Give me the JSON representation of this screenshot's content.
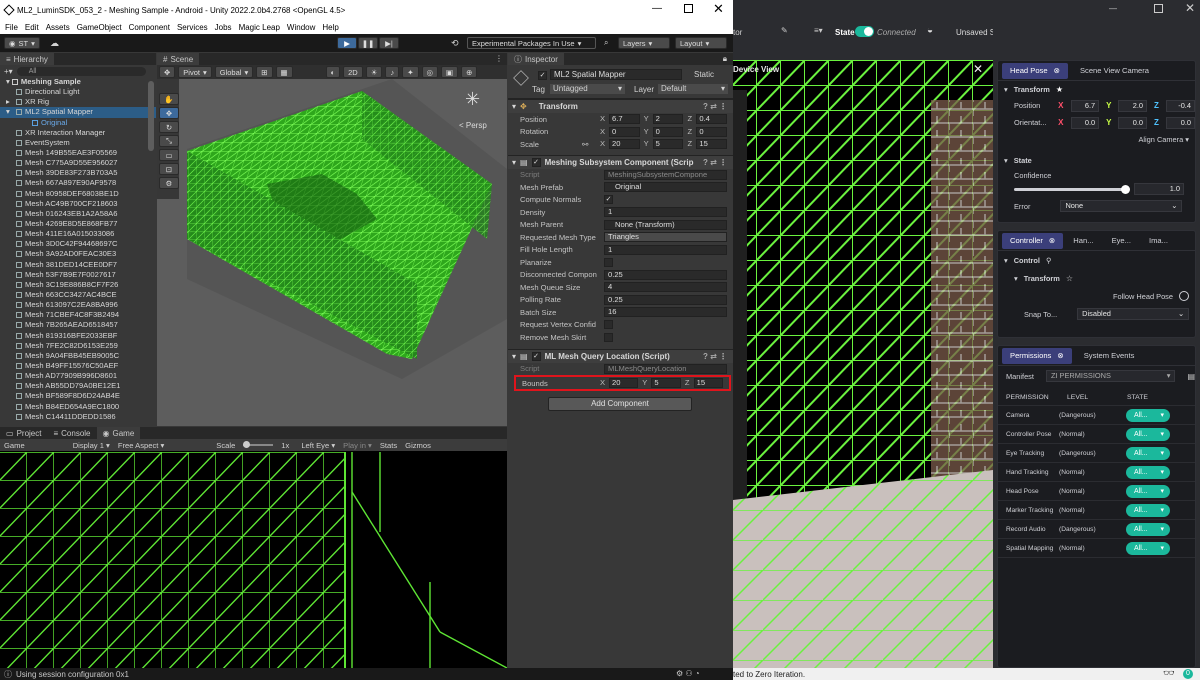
{
  "unity": {
    "title": "ML2_LuminSDK_053_2 - Meshing Sample - Android - Unity 2022.2.0b4.2768 <OpenGL 4.5>",
    "menu": [
      "File",
      "Edit",
      "Assets",
      "GameObject",
      "Component",
      "Services",
      "Jobs",
      "Magic Leap",
      "Window",
      "Help"
    ],
    "account": "ST",
    "experimental": "Experimental Packages In Use",
    "layers": "Layers",
    "layout": "Layout",
    "hierarchy_tab": "Hierarchy",
    "search_placeholder": "All",
    "scene_root": "Meshing Sample",
    "hierarchy": [
      "Directional Light",
      "XR Rig",
      "ML2 Spatial Mapper",
      "Original",
      "XR Interaction Manager",
      "EventSystem",
      "Mesh 149B55EAE3F05569",
      "Mesh C775A9D55E956027",
      "Mesh 39DE83F273B703A5",
      "Mesh 667A897E90AF9578",
      "Mesh 80958DEF6803BE1D",
      "Mesh AC49B700CF218603",
      "Mesh 016243EB1A2A58A6",
      "Mesh 4269E8D5E868FB77",
      "Mesh 411E16A015033086",
      "Mesh 3D0C42F94468697C",
      "Mesh 3A92AD0FEAC30E3",
      "Mesh 381DED14CEE0DF7",
      "Mesh 53F7B9E7F0027617",
      "Mesh 3C19E886B8CF7F26",
      "Mesh 663CC3427AC4BCE",
      "Mesh 613097C2EA8BA996",
      "Mesh 71CBEF4C8F3B2494",
      "Mesh 7B265AEAD6518457",
      "Mesh 819316BFE2033EBF",
      "Mesh 7FE2C82D6153E259",
      "Mesh 9A04FBB45EB9005C",
      "Mesh B49FF15576C50AEF",
      "Mesh AD77909B996D8601",
      "Mesh AB55DD79A0BE12E1",
      "Mesh BF589F8D6D24AB4E",
      "Mesh B84ED654A9EC1800",
      "Mesh C14411DDEDD1586"
    ],
    "scene_tab": "Scene",
    "scene_tools": {
      "pivot": "Pivot",
      "global": "Global",
      "mode": "2D",
      "persp": "< Persp"
    },
    "bottom_tabs": [
      "Project",
      "Console",
      "Game"
    ],
    "game_bar": {
      "display": "Game",
      "display_num": "Display 1",
      "aspect": "Free Aspect",
      "scale_label": "Scale",
      "scale_value": "1x",
      "eye": "Left Eye",
      "play": "Play in",
      "stats": "Stats",
      "gizmos": "Gizmos"
    },
    "status": "Using session configuration 0x1",
    "inspector": {
      "tab": "Inspector",
      "object_name": "ML2 Spatial Mapper",
      "static": "Static",
      "tag_label": "Tag",
      "tag": "Untagged",
      "layer_label": "Layer",
      "layer": "Default",
      "transform": {
        "title": "Transform",
        "position": {
          "label": "Position",
          "x": "6.7",
          "y": "2",
          "z": "0.4"
        },
        "rotation": {
          "label": "Rotation",
          "x": "0",
          "y": "0",
          "z": "0"
        },
        "scale": {
          "label": "Scale",
          "x": "20",
          "y": "5",
          "z": "15"
        }
      },
      "meshing": {
        "title": "Meshing Subsystem Component (Scrip",
        "script_label": "Script",
        "script": "MeshingSubsystemCompone",
        "fields": [
          {
            "label": "Mesh Prefab",
            "value": "Original",
            "kind": "obj"
          },
          {
            "label": "Compute Normals",
            "value": "✓",
            "kind": "chk"
          },
          {
            "label": "Density",
            "value": "1",
            "kind": "val"
          },
          {
            "label": "Mesh Parent",
            "value": "None (Transform)",
            "kind": "obj"
          },
          {
            "label": "Requested Mesh Type",
            "value": "Triangles",
            "kind": "dd"
          },
          {
            "label": "Fill Hole Length",
            "value": "1",
            "kind": "val"
          },
          {
            "label": "Planarize",
            "value": "",
            "kind": "chk"
          },
          {
            "label": "Disconnected Compon",
            "value": "0.25",
            "kind": "val"
          },
          {
            "label": "Mesh Queue Size",
            "value": "4",
            "kind": "val"
          },
          {
            "label": "Polling Rate",
            "value": "0.25",
            "kind": "val"
          },
          {
            "label": "Batch Size",
            "value": "16",
            "kind": "val"
          },
          {
            "label": "Request Vertex Confid",
            "value": "",
            "kind": "chk"
          },
          {
            "label": "Remove Mesh Skirt",
            "value": "",
            "kind": "chk"
          }
        ]
      },
      "query": {
        "title": "ML Mesh Query Location (Script)",
        "script_label": "Script",
        "script": "MLMeshQueryLocation",
        "bounds": {
          "label": "Bounds",
          "x": "20",
          "y": "5",
          "z": "15"
        }
      },
      "add_component": "Add Component",
      "highlight_color": "#e0141c"
    }
  },
  "device_view": {
    "title": "Device View"
  },
  "simulator": {
    "app_title_partial": "tor",
    "state_label": "State",
    "state_value": "Connected",
    "session": "Unsaved Session",
    "head_tabs": [
      "Head Pose",
      "Scene View Camera"
    ],
    "transform_label": "Transform",
    "position": {
      "label": "Position",
      "x": "6.7",
      "y": "2.0",
      "z": "-0.4"
    },
    "orientation": {
      "label": "Orientat...",
      "x": "0.0",
      "y": "0.0",
      "z": "0.0"
    },
    "align_camera": "Align Camera",
    "state_section": "State",
    "confidence_label": "Confidence",
    "confidence_value": "1.0",
    "confidence_level": 1.0,
    "error_label": "Error",
    "error_value": "None",
    "controller_tabs": [
      "Controller",
      "Han...",
      "Eye...",
      "Ima..."
    ],
    "control_label": "Control",
    "ctrl_transform": "Transform",
    "follow_head": "Follow Head Pose",
    "snap_label": "Snap To...",
    "snap_value": "Disabled",
    "perm_tabs": [
      "Permissions",
      "System Events"
    ],
    "manifest_label": "Manifest",
    "manifest_value": "ZI PERMISSIONS",
    "perm_headers": [
      "PERMISSION",
      "LEVEL",
      "STATE"
    ],
    "permissions": [
      {
        "name": "Camera",
        "level": "(Dangerous)",
        "state": "All..."
      },
      {
        "name": "Controller Pose",
        "level": "(Normal)",
        "state": "All..."
      },
      {
        "name": "Eye Tracking",
        "level": "(Dangerous)",
        "state": "All..."
      },
      {
        "name": "Hand Tracking",
        "level": "(Normal)",
        "state": "All..."
      },
      {
        "name": "Head Pose",
        "level": "(Normal)",
        "state": "All..."
      },
      {
        "name": "Marker Tracking",
        "level": "(Normal)",
        "state": "All..."
      },
      {
        "name": "Record Audio",
        "level": "(Dangerous)",
        "state": "All..."
      },
      {
        "name": "Spatial Mapping",
        "level": "(Normal)",
        "state": "All..."
      }
    ],
    "footer": "ted to Zero Iteration.",
    "footer_badge": "0",
    "accent": "#3b3f7a",
    "toggle_color": "#1bb89c"
  }
}
